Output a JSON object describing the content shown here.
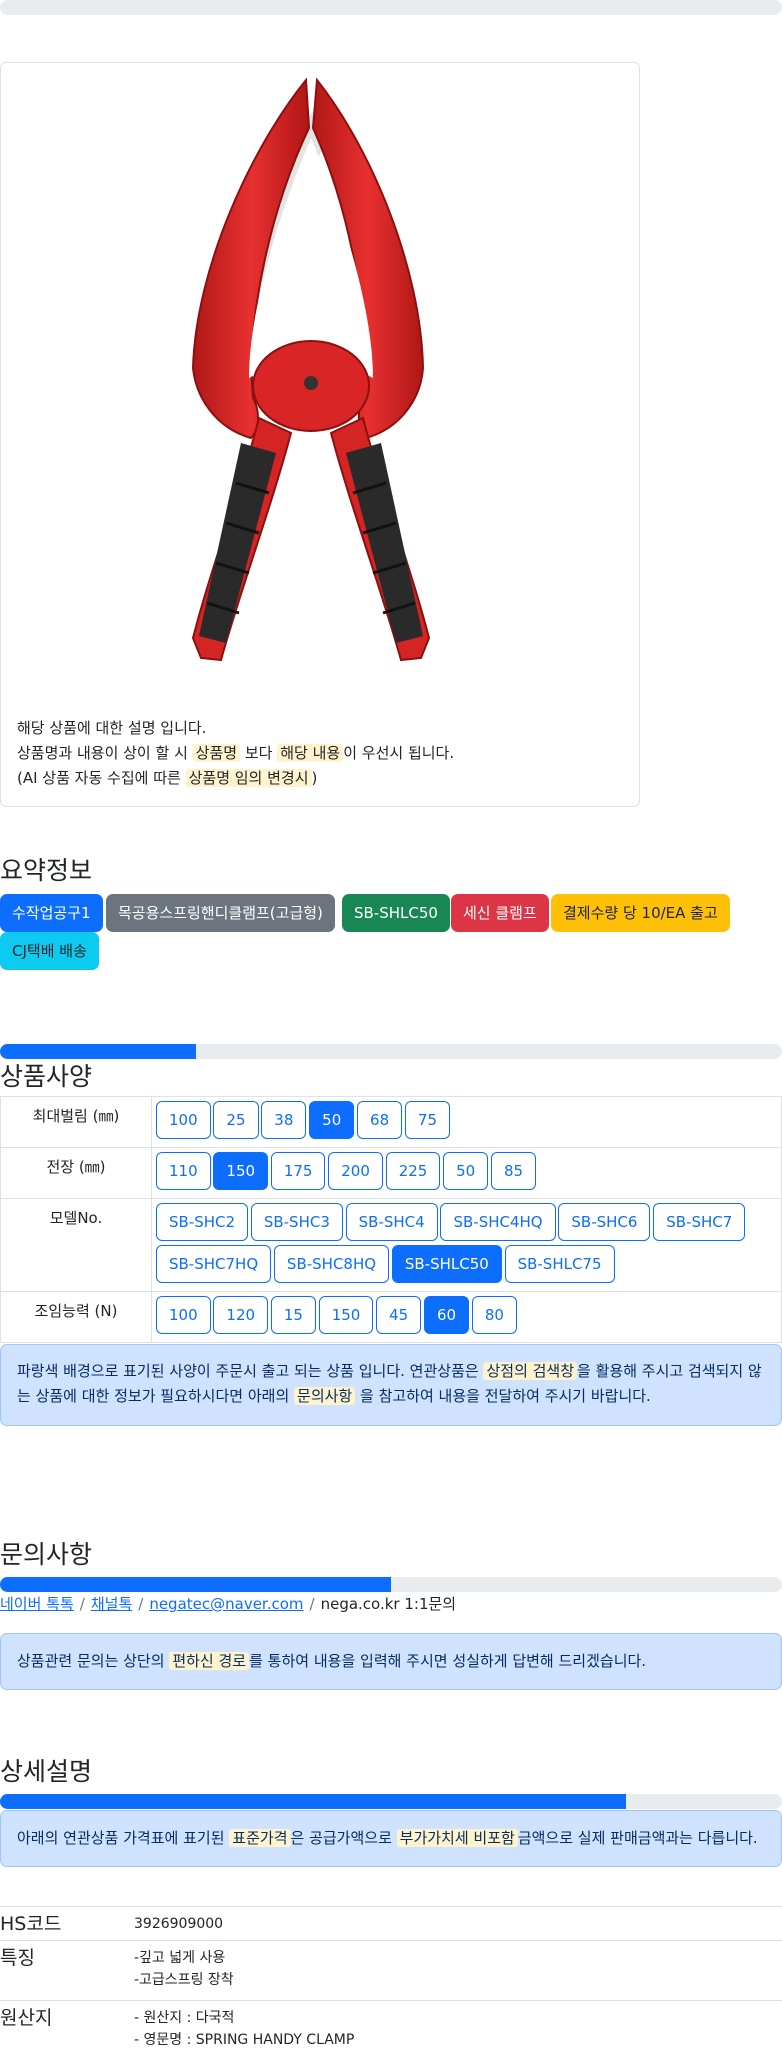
{
  "card": {
    "line1": "해당 상품에 대한 설명 입니다.",
    "line2_a": "상품명과 내용이 상이 할 시",
    "line2_hl1": "상품명",
    "line2_b": "보다",
    "line2_hl2": "해당 내용",
    "line2_c": "이 우선시 됩니다.",
    "line3_a": "(AI 상품 자동 수집에 따른",
    "line3_hl": "상품명 임의 변경시",
    "line3_b": ")"
  },
  "summary": {
    "title": "요약정보",
    "badges": [
      "수작업공구1",
      "목공용스프링핸디클램프(고급형)",
      "SB-SHLC50",
      "세신 클램프",
      "결제수량 당 10/EA 출고",
      "CJ택배 배송"
    ],
    "colors": [
      "#0d6efd",
      "#6c757d",
      "#198754",
      "#dc3545",
      "#ffc107",
      "#0dcaf0"
    ]
  },
  "spec": {
    "title": "상품사양",
    "progress": 0.25,
    "rows": [
      {
        "label": "최대벌림 (㎜)",
        "options": [
          "100",
          "25",
          "38",
          "50",
          "68",
          "75"
        ],
        "selected": "50"
      },
      {
        "label": "전장 (㎜)",
        "options": [
          "110",
          "150",
          "175",
          "200",
          "225",
          "50",
          "85"
        ],
        "selected": "150"
      },
      {
        "label": "모델No.",
        "options": [
          "SB-SHC2",
          "SB-SHC3",
          "SB-SHC4",
          "SB-SHC4HQ",
          "SB-SHC6",
          "SB-SHC7",
          "SB-SHC7HQ",
          "SB-SHC8HQ",
          "SB-SHLC50",
          "SB-SHLC75"
        ],
        "selected": "SB-SHLC50"
      },
      {
        "label": "조임능력 (N)",
        "options": [
          "100",
          "120",
          "15",
          "150",
          "45",
          "60",
          "80"
        ],
        "selected": "60"
      }
    ],
    "notice_a": "파랑색 배경으로 표기된 사양이 주문시 출고 되는 상품 입니다. 연관상품은",
    "notice_hl1": "상점의 검색창",
    "notice_b": "을 활용해 주시고 검색되지 않는 상품에 대한 정보가 필요하시다면 아래의",
    "notice_hl2": "문의사항",
    "notice_c": "을 참고하여 내용을 전달하여 주시기 바랍니다."
  },
  "inquiry": {
    "title": "문의사항",
    "progress": 0.5,
    "links": [
      "네이버 톡톡",
      "채널톡",
      "negatec@naver.com"
    ],
    "last": "nega.co.kr 1:1문의",
    "notice_a": "상품관련 문의는 상단의",
    "notice_hl": "편하신 경로",
    "notice_b": "를 통하여 내용을 입력해 주시면 성실하게 답변해 드리겠습니다."
  },
  "detail": {
    "title": "상세설명",
    "progress": 0.8,
    "notice_a": "아래의 연관상품 가격표에 표기된",
    "notice_hl1": "표준가격",
    "notice_b": "은 공급가액으로",
    "notice_hl2": "부가가치세 비포함",
    "notice_c": "금액으로 실제 판매금액과는 다릅니다."
  },
  "info": {
    "hs_label": "HS코드",
    "hs_value": "3926909000",
    "feat_label": "특징",
    "feat_1": "-깊고 넓게 사용",
    "feat_2": "-고급스프링 장착",
    "origin_label": "원산지",
    "origin_1": "- 원산지 : 다국적",
    "origin_2": "- 영문명 : SPRING HANDY CLAMP"
  }
}
